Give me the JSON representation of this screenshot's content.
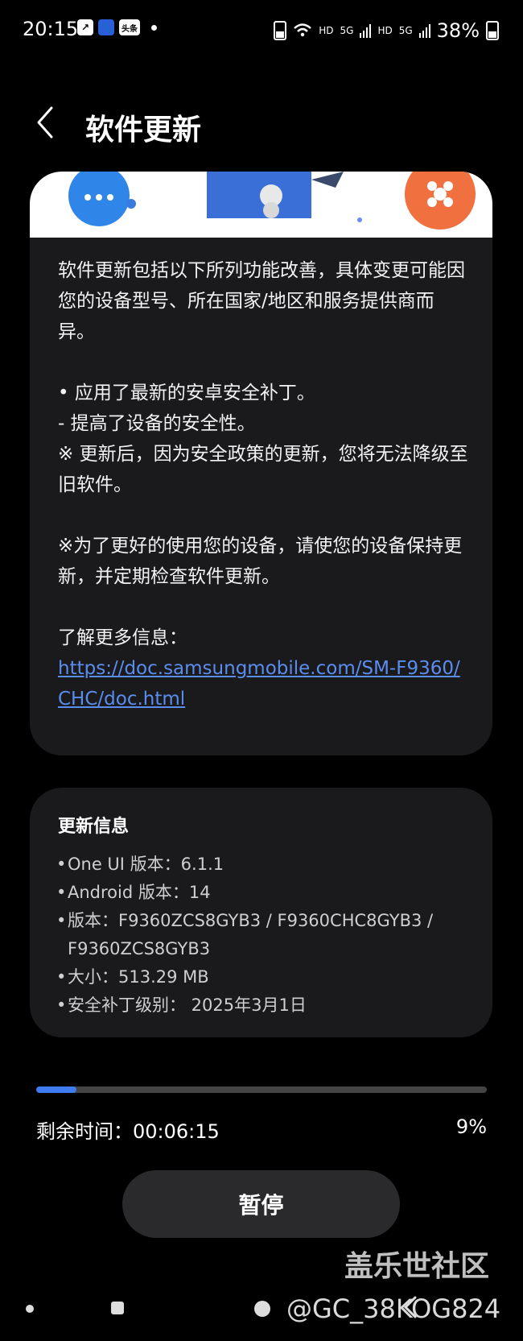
{
  "status_bar": {
    "time": "20:15",
    "left_icons": [
      "app-icon",
      "baidu-icon",
      "toutiao-icon"
    ],
    "toutiao_label": "头条",
    "network": [
      "HD",
      "5G",
      "HD",
      "5G"
    ],
    "battery": "38%"
  },
  "header": {
    "title": "软件更新"
  },
  "description": {
    "intro": "软件更新包括以下所列功能改善，具体变更可能因您的设备型号、所在国家/地区和服务提供商而异。",
    "line1": "• 应用了最新的安卓安全补丁。",
    "line2": " - 提高了设备的安全性。",
    "line3": "※ 更新后，因为安全政策的更新，您将无法降级至旧软件。",
    "line4": "※为了更好的使用您的设备，请使您的设备保持更新，并定期检查软件更新。",
    "more_label": "了解更多信息：",
    "link": "https://doc.samsungmobile.com/SM-F9360/CHC/doc.html"
  },
  "update_info": {
    "title": "更新信息",
    "items": [
      "One UI 版本：6.1.1",
      "Android 版本：14",
      "版本：F9360ZCS8GYB3 / F9360CHC8GYB3 / F9360ZCS8GYB3",
      "大小：513.29 MB",
      "安全补丁级别： 2025年3月1日"
    ]
  },
  "progress": {
    "remaining_label": "剩余时间：00:06:15",
    "percent_label": "9%",
    "value": 0.09
  },
  "pause_button": "暂停",
  "watermark": "盖乐世社区",
  "handle": "@GC_38KOG824",
  "colors": {
    "accent": "#3f7cf2",
    "link": "#5b8def",
    "card": "#1a1a1c",
    "background": "#000000"
  }
}
